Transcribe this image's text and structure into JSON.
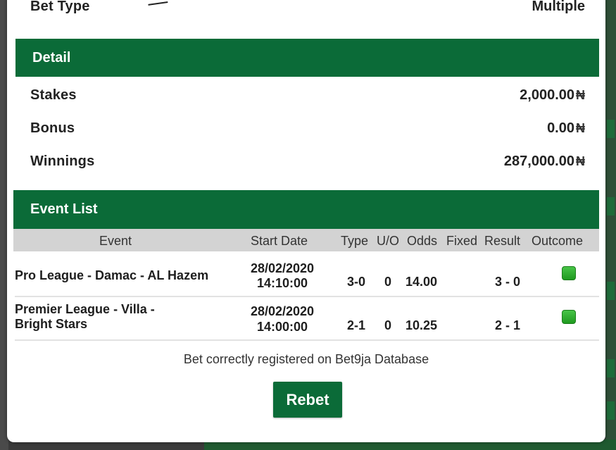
{
  "bet_type": {
    "label": "Bet Type",
    "value": "Multiple"
  },
  "detail": {
    "title": "Detail",
    "currency_symbol": "₦",
    "rows": [
      {
        "label": "Stakes",
        "value": "2,000.00"
      },
      {
        "label": "Bonus",
        "value": "0.00"
      },
      {
        "label": "Winnings",
        "value": "287,000.00"
      }
    ]
  },
  "event_list": {
    "title": "Event List",
    "columns": [
      "Event",
      "Start Date",
      "Type",
      "U/O",
      "Odds",
      "Fixed",
      "Result",
      "Outcome"
    ],
    "rows": [
      {
        "event": "Pro League - Damac - AL Hazem",
        "start_date": "28/02/2020",
        "start_time": "14:10:00",
        "type": "3-0",
        "uo": "0",
        "odds": "14.00",
        "result": "3 - 0",
        "outcome": "won"
      },
      {
        "event_line1": "Premier League - Villa -",
        "event_line2": "Bright Stars",
        "start_date": "28/02/2020",
        "start_time": "14:00:00",
        "type": "2-1",
        "uo": "0",
        "odds": "10.25",
        "result": "2 - 1",
        "outcome": "won"
      }
    ]
  },
  "note": "Bet correctly registered on Bet9ja Database",
  "rebet_label": "Rebet",
  "colors": {
    "brand_green": "#0b6b38",
    "table_header": "#d3d3d3",
    "outcome_green": "#33b233"
  }
}
